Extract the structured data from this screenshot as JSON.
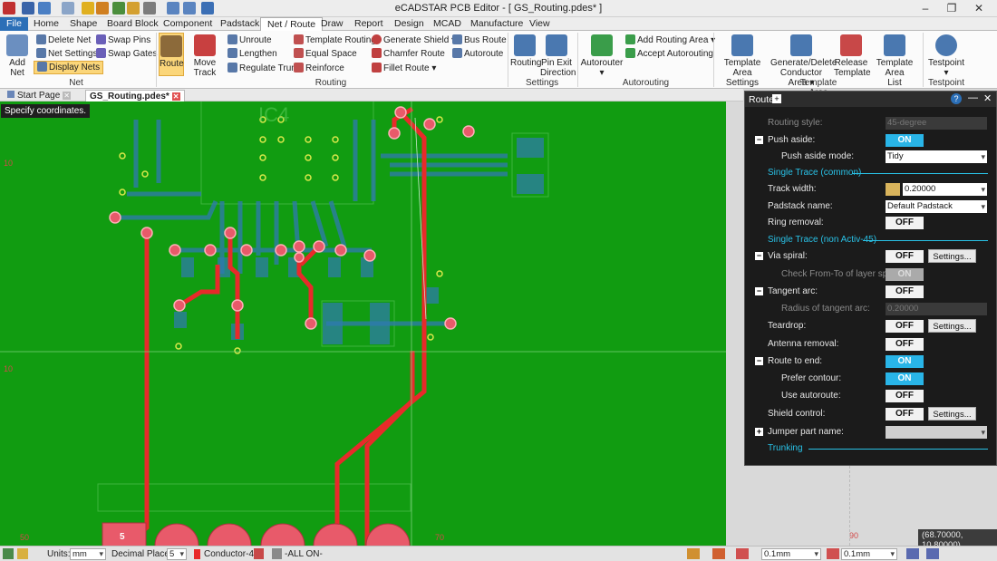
{
  "app": {
    "title": "eCADSTAR PCB Editor - [ GS_Routing.pdes* ]",
    "min": "–",
    "max": "❐",
    "close": "✕"
  },
  "menu": [
    "File",
    "Home",
    "Shape",
    "Board Block",
    "Component",
    "Padstack",
    "Net / Route",
    "Draw",
    "Report",
    "Design",
    "MCAD",
    "Manufacture",
    "View"
  ],
  "ribbon": {
    "addnet": "Add Net",
    "delete_net": "Delete Net",
    "net_settings": "Net Settings",
    "display_nets": "Display Nets",
    "swap_pins": "Swap Pins",
    "swap_gates": "Swap Gates",
    "net_group": "Net",
    "route": "Route",
    "move_track": "Move Track",
    "unroute": "Unroute",
    "lengthen": "Lengthen",
    "regulate_trunk": "Regulate Trunk",
    "template_routing": "Template Routing",
    "equal_space": "Equal Space",
    "reinforce": "Reinforce",
    "generate_shield": "Generate Shield",
    "chamfer_route": "Chamfer Route",
    "fillet_route": "Fillet Route",
    "bus_route": "Bus Route",
    "autoroute": "Autoroute",
    "routing_group": "Routing",
    "routing_settings": "Routing",
    "pin_exit_1": "Pin Exit",
    "pin_exit_2": "Direction",
    "settings_group": "Settings",
    "autorouter": "Autorouter",
    "add_routing_area": "Add Routing Area",
    "accept_autorouting": "Accept Autorouting",
    "autorouting_group": "Autorouting",
    "tas_1": "Template Area",
    "tas_2": "Settings",
    "gdc_1": "Generate/Delete",
    "gdc_2": "Conductor Area",
    "rel_1": "Release",
    "rel_2": "Template",
    "tal_1": "Template Area",
    "tal_2": "List",
    "template_group": "Template Area",
    "testpoint": "Testpoint",
    "testpoint_group": "Testpoint"
  },
  "tabs": {
    "start": "Start Page",
    "routing": "GS_Routing.pdes*"
  },
  "prompt": "Specify coordinates.",
  "board": {
    "label_ic4": "IC4",
    "ruler_50": "50",
    "ruler_70": "70",
    "ruler_90": "90",
    "ruler_10a": "10",
    "ruler_10b": "10",
    "bottom_pad": "5"
  },
  "panel": {
    "title": "Route",
    "help": "?",
    "routing_style_label": "Routing style:",
    "routing_style_value": "45-degree",
    "push_aside_label": "Push aside:",
    "push_aside_value": "ON",
    "push_aside_mode_label": "Push aside mode:",
    "push_aside_mode_value": "Tidy",
    "section_single_common": "Single Trace (common)",
    "track_width_label": "Track width:",
    "track_width_value": "0.20000",
    "padstack_label": "Padstack name:",
    "padstack_value": "Default Padstack",
    "ring_removal_label": "Ring removal:",
    "ring_removal_value": "OFF",
    "section_single_non": "Single Trace (non Activ-45)",
    "via_spiral_label": "Via spiral:",
    "via_spiral_value": "OFF",
    "check_from_to_label": "Check From-To of layer span:",
    "check_from_to_value": "ON",
    "tangent_arc_label": "Tangent arc:",
    "tangent_arc_value": "OFF",
    "radius_label": "Radius of tangent arc:",
    "radius_value": "0.20000",
    "teardrop_label": "Teardrop:",
    "teardrop_value": "OFF",
    "antenna_label": "Antenna removal:",
    "antenna_value": "OFF",
    "route_end_label": "Route to end:",
    "route_end_value": "ON",
    "prefer_contour_label": "Prefer contour:",
    "prefer_contour_value": "ON",
    "use_autoroute_label": "Use autoroute:",
    "use_autoroute_value": "OFF",
    "shield_label": "Shield control:",
    "shield_value": "OFF",
    "jumper_label": "Jumper part name:",
    "section_trunking": "Trunking",
    "settings_btn": "Settings..."
  },
  "status": {
    "units_label": "Units:",
    "units_value": "mm",
    "decimal_label": "Decimal Places:",
    "decimal_value": "5",
    "layer": "Conductor-4",
    "layers": "-ALL ON-",
    "width1": "0.1mm",
    "width2": "0.1mm"
  },
  "coord_readout": "(68.70000, 10.80000)",
  "colors": {
    "board": "#119c11",
    "track": "#e82a2a",
    "accent": "#29b5e8",
    "menu_file": "#2b6fb7"
  }
}
